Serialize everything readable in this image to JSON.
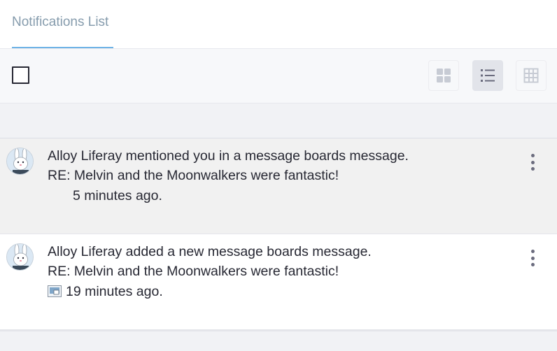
{
  "tabs": {
    "active_label": "Notifications List"
  },
  "toolbar": {
    "select_all_checked": false,
    "view_options": [
      {
        "name": "cards",
        "icon": "cards-icon",
        "active": false
      },
      {
        "name": "list",
        "icon": "list-icon",
        "active": true
      },
      {
        "name": "table",
        "icon": "table-icon",
        "active": false
      }
    ]
  },
  "notifications": [
    {
      "title": "Alloy Liferay mentioned you in a message boards message.",
      "subject": "RE: Melvin and the Moonwalkers were fantastic!",
      "time": "5 minutes ago.",
      "read": false,
      "has_attachment_icon": false
    },
    {
      "title": "Alloy Liferay added a new message boards message.",
      "subject": "RE: Melvin and the Moonwalkers were fantastic!",
      "time": "19 minutes ago.",
      "read": true,
      "has_attachment_icon": true
    }
  ],
  "colors": {
    "accent": "#6fb3e6",
    "tab_text": "#869cad",
    "text": "#272833"
  }
}
